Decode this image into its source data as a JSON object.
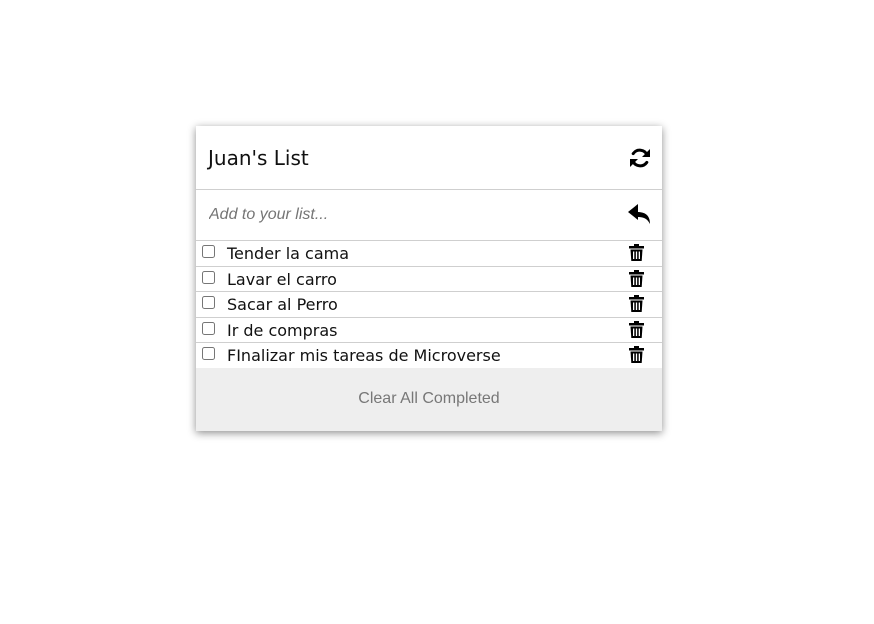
{
  "list": {
    "title": "Juan's List",
    "refresh_icon": "refresh-icon"
  },
  "add": {
    "placeholder": "Add to your list...",
    "value": "",
    "enter_icon": "return-arrow-icon"
  },
  "items": [
    {
      "label": "Tender la cama",
      "checked": false
    },
    {
      "label": "Lavar el carro",
      "checked": false
    },
    {
      "label": "Sacar al Perro",
      "checked": false
    },
    {
      "label": "Ir de compras",
      "checked": false
    },
    {
      "label": "FInalizar mis tareas de Microverse",
      "checked": false
    }
  ],
  "footer": {
    "clear_label": "Clear All Completed"
  },
  "colors": {
    "footer_bg": "#eeeeee",
    "footer_text": "#777777",
    "divider": "#cfcfcf"
  }
}
